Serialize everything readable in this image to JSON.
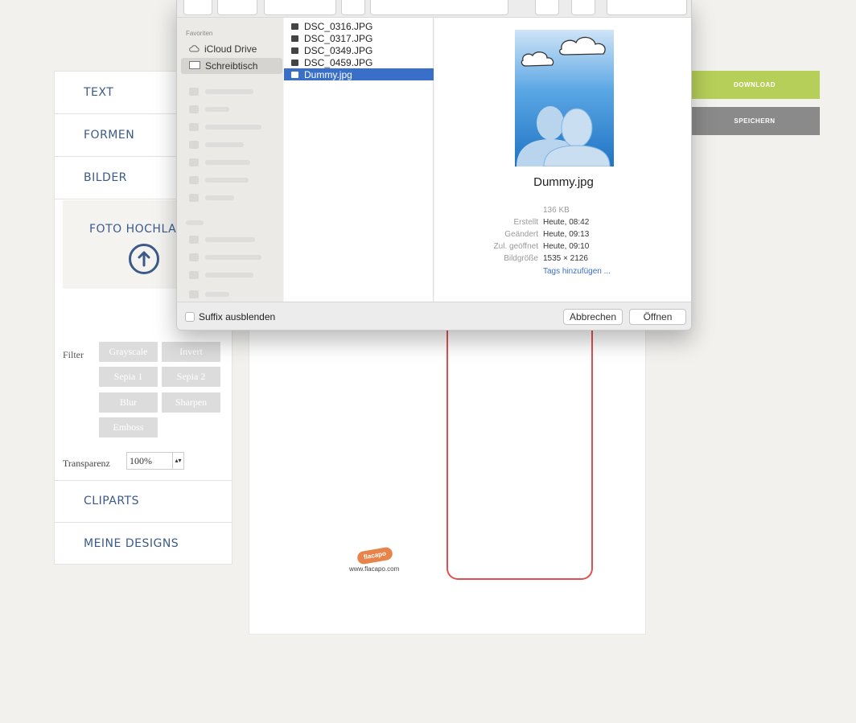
{
  "left_panel": {
    "accordions": [
      "TEXT",
      "FORMEN",
      "BILDER"
    ],
    "upload_title": "FOTO HOCHLADEN",
    "filter_label": "Filter",
    "filters": [
      "Grayscale",
      "Invert",
      "Sepia 1",
      "Sepia 2",
      "Blur",
      "Sharpen",
      "Emboss"
    ],
    "transparency_label": "Transparenz",
    "transparency_value": "100%",
    "bottom_accordions": [
      "CLIPARTS",
      "MEINE DESIGNS"
    ]
  },
  "right_buttons": {
    "download": "DOWNLOAD",
    "save": "SPEICHERN",
    "download_color": "#b6cf58",
    "save_color": "#8a8a8a"
  },
  "canvas": {
    "logo_text": "flacapo",
    "logo_url": "www.flacapo.com"
  },
  "dialog": {
    "sidebar_section": "Favoriten",
    "sidebar_items": [
      "iCloud Drive",
      "Schreibtisch"
    ],
    "files": [
      "DSC_0316.JPG",
      "DSC_0317.JPG",
      "DSC_0349.JPG",
      "DSC_0459.JPG",
      "Dummy.jpg"
    ],
    "selected_file": "Dummy.jpg",
    "preview": {
      "name": "Dummy.jpg",
      "size": "136 KB",
      "meta": [
        {
          "key": "Erstellt",
          "value": "Heute, 08:42"
        },
        {
          "key": "Geändert",
          "value": "Heute, 09:13"
        },
        {
          "key": "Zul. geöffnet",
          "value": "Heute, 09:10"
        },
        {
          "key": "Bildgröße",
          "value": "1535 × 2126"
        }
      ],
      "tags_link": "Tags hinzufügen ..."
    },
    "hide_suffix_label": "Suffix ausblenden",
    "cancel_label": "Abbrechen",
    "open_label": "Öffnen"
  }
}
